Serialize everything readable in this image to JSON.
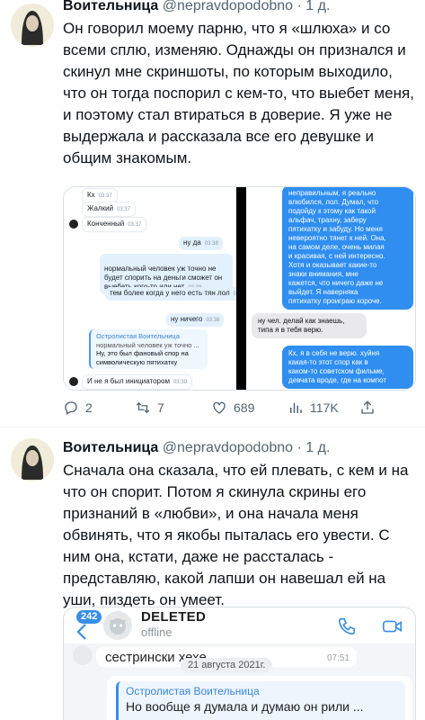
{
  "tweets": [
    {
      "author_name": "Воительница",
      "handle": "@nepravdopodobno",
      "separator": "·",
      "time": "1 д.",
      "text": "Он говорил моему парню, что я «шлюха» и со всеми сплю, изменяю. Однажды он признался и скинул мне скриншоты, по которым выходило, что он тогда поспорил с кем-то, что выебет меня, и поэтому стал втираться в доверие. Я уже не выдержала и рассказала все его девушке и общим знакомым.",
      "screenshot": {
        "left_chat": [
          {
            "text": "Кх",
            "time": "03:37",
            "side": "in"
          },
          {
            "text": "Жалкий",
            "time": "03:37",
            "side": "in"
          },
          {
            "text": "Конченный",
            "time": "03:37",
            "side": "in"
          },
          {
            "text": "ну да",
            "time": "03:38",
            "side": "out"
          },
          {
            "text": "нормальный человек уж точно не\nбудет спорить на деньги сможет он\nвыебать кого-то или нет",
            "time": "03:38",
            "side": "out"
          },
          {
            "text": "тем более когда у него есть тян лол",
            "time": "03:38",
            "side": "out"
          },
          {
            "text": "ну ничего",
            "time": "03:38",
            "side": "out"
          },
          {
            "text": "И не я был инициатором",
            "time": "03:39",
            "side": "in"
          }
        ],
        "left_quote": {
          "author": "Остролистая Воительница",
          "quoted": "нормальный человек уж точно ...",
          "text": "Ну, это был фановый спор на\nсимволическую пятихатку",
          "time": "03:38"
        },
        "right_chat": [
          {
            "text": "неправильным, я реально\nвлюбился, лол. Думал, что\nподойду к этому как такой\nальфач, трахну, заберу\nпятихатку и забуду. Но меня\nневероятно тянет к ней. Она,\nна самом деле, очень милая\nи красивая, с ней интересно.\nХотя и оказывает какие-то\nзнаки внимания, мне\nкажется, что ничего даже не\nвыйдет. Я наверняка\nпятихатку проиграю короче.",
            "side": "out"
          },
          {
            "text": "ну чел. делай как знаешь,\nтипа я в тебя верю.",
            "side": "in"
          },
          {
            "text": "Кх, я в себя не верю. хуйня\nкакая-то этот спор как в\nкаком-то советском фильме,\nдевчата вроде, где на компот",
            "side": "out"
          }
        ]
      },
      "actions": {
        "replies": "2",
        "retweets": "7",
        "likes": "689",
        "views": "117K"
      }
    },
    {
      "author_name": "Воительница",
      "handle": "@nepravdopodobno",
      "separator": "·",
      "time": "1 д.",
      "text": "Сначала она сказала, что ей плевать, с кем и на что он спорит. Потом я скинула скрины его признаний в «любви», и она начала меня обвинять, что я якобы пыталась его увести. С ним она, кстати, даже не рассталась - представляю, какой лапши он навешал ей на уши, пиздеть он умеет.",
      "screenshot": {
        "badge": "242",
        "contact_name": "DELETED",
        "contact_status": "offline",
        "msg1": "сестрински хехе",
        "msg1_time": "07:51",
        "date_chip": "21 августа 2021г.",
        "quote_author": "Остролистая Воительница",
        "quote_text": "Но вообще я думала и думаю он рили ..."
      }
    }
  ]
}
